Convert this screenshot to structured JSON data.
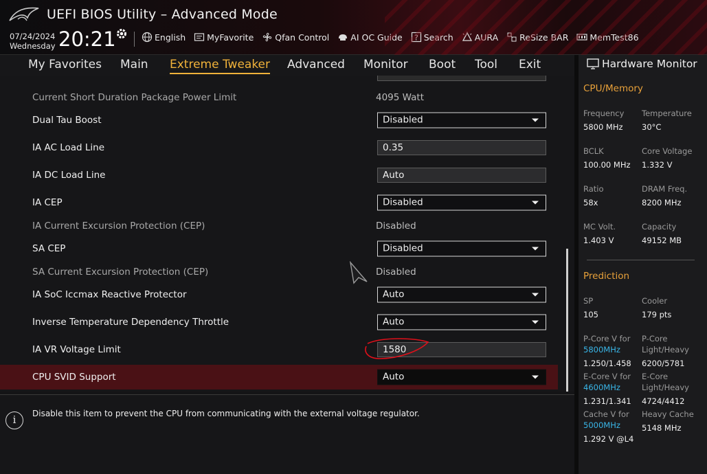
{
  "header": {
    "title": "UEFI BIOS Utility – Advanced Mode",
    "date": "07/24/2024",
    "weekday": "Wednesday",
    "time": "20:21",
    "tools": [
      {
        "label": "English",
        "icon": "globe-icon"
      },
      {
        "label": "MyFavorite",
        "icon": "favorite-icon"
      },
      {
        "label": "Qfan Control",
        "icon": "fan-icon"
      },
      {
        "label": "AI OC Guide",
        "icon": "ai-oc-icon"
      },
      {
        "label": "Search",
        "icon": "search-icon"
      },
      {
        "label": "AURA",
        "icon": "aura-icon"
      },
      {
        "label": "ReSize BAR",
        "icon": "resize-bar-icon"
      },
      {
        "label": "MemTest86",
        "icon": "memtest-icon"
      }
    ]
  },
  "nav": {
    "items": [
      "My Favorites",
      "Main",
      "Extreme Tweaker",
      "Advanced",
      "Monitor",
      "Boot",
      "Tool",
      "Exit"
    ],
    "active": "Extreme Tweaker"
  },
  "settings": [
    {
      "label": "Current Short Duration Package Power Limit",
      "type": "text",
      "value": "4095 Watt",
      "dim": true
    },
    {
      "label": "Dual Tau Boost",
      "type": "dropdown",
      "value": "Disabled"
    },
    {
      "label": "IA AC Load Line",
      "type": "field",
      "value": "0.35"
    },
    {
      "label": "IA DC Load Line",
      "type": "field",
      "value": "Auto"
    },
    {
      "label": "IA CEP",
      "type": "dropdown",
      "value": "Disabled"
    },
    {
      "label": "IA Current Excursion Protection (CEP)",
      "type": "text",
      "value": "Disabled",
      "dim": true
    },
    {
      "label": "SA CEP",
      "type": "dropdown",
      "value": "Disabled"
    },
    {
      "label": "SA Current Excursion Protection (CEP)",
      "type": "text",
      "value": "Disabled",
      "dim": true
    },
    {
      "label": "IA SoC Iccmax Reactive Protector",
      "type": "dropdown",
      "value": "Auto"
    },
    {
      "label": "Inverse Temperature Dependency Throttle",
      "type": "dropdown",
      "value": "Auto"
    },
    {
      "label": "IA VR Voltage Limit",
      "type": "field",
      "value": "1580"
    },
    {
      "label": "CPU SVID Support",
      "type": "dropdown",
      "value": "Auto",
      "selected": true
    }
  ],
  "help": {
    "text": "Disable this item to prevent the CPU from communicating with the external voltage regulator."
  },
  "hardware_monitor": {
    "title": "Hardware Monitor",
    "cpu_memory_title": "CPU/Memory",
    "cpu_memory": [
      {
        "k": "Frequency",
        "v": "5800 MHz"
      },
      {
        "k": "Temperature",
        "v": "30°C"
      },
      {
        "k": "BCLK",
        "v": "100.00 MHz"
      },
      {
        "k": "Core Voltage",
        "v": "1.332 V"
      },
      {
        "k": "Ratio",
        "v": "58x"
      },
      {
        "k": "DRAM Freq.",
        "v": "8200 MHz"
      },
      {
        "k": "MC Volt.",
        "v": "1.403 V"
      },
      {
        "k": "Capacity",
        "v": "49152 MB"
      }
    ],
    "prediction_title": "Prediction",
    "prediction": [
      {
        "k": "SP",
        "v": "105"
      },
      {
        "k": "Cooler",
        "v": "179 pts"
      },
      {
        "k": "P-Core V for",
        "k2": "5800MHz",
        "v": "1.250/1.458"
      },
      {
        "k": "P-Core",
        "k2": "Light/Heavy",
        "v": "6200/5781"
      },
      {
        "k": "E-Core V for",
        "k2": "4600MHz",
        "v": "1.231/1.341"
      },
      {
        "k": "E-Core",
        "k2": "Light/Heavy",
        "v": "4724/4412"
      },
      {
        "k": "Cache V for",
        "k2": "5000MHz",
        "v": "1.292 V @L4"
      },
      {
        "k": "Heavy Cache",
        "v": "5148 MHz"
      }
    ]
  },
  "colors": {
    "accent": "#f0b23a",
    "selected_row": "#4a1115",
    "highlight_blue": "#39b6e8",
    "annotation_red": "#e0101a"
  }
}
